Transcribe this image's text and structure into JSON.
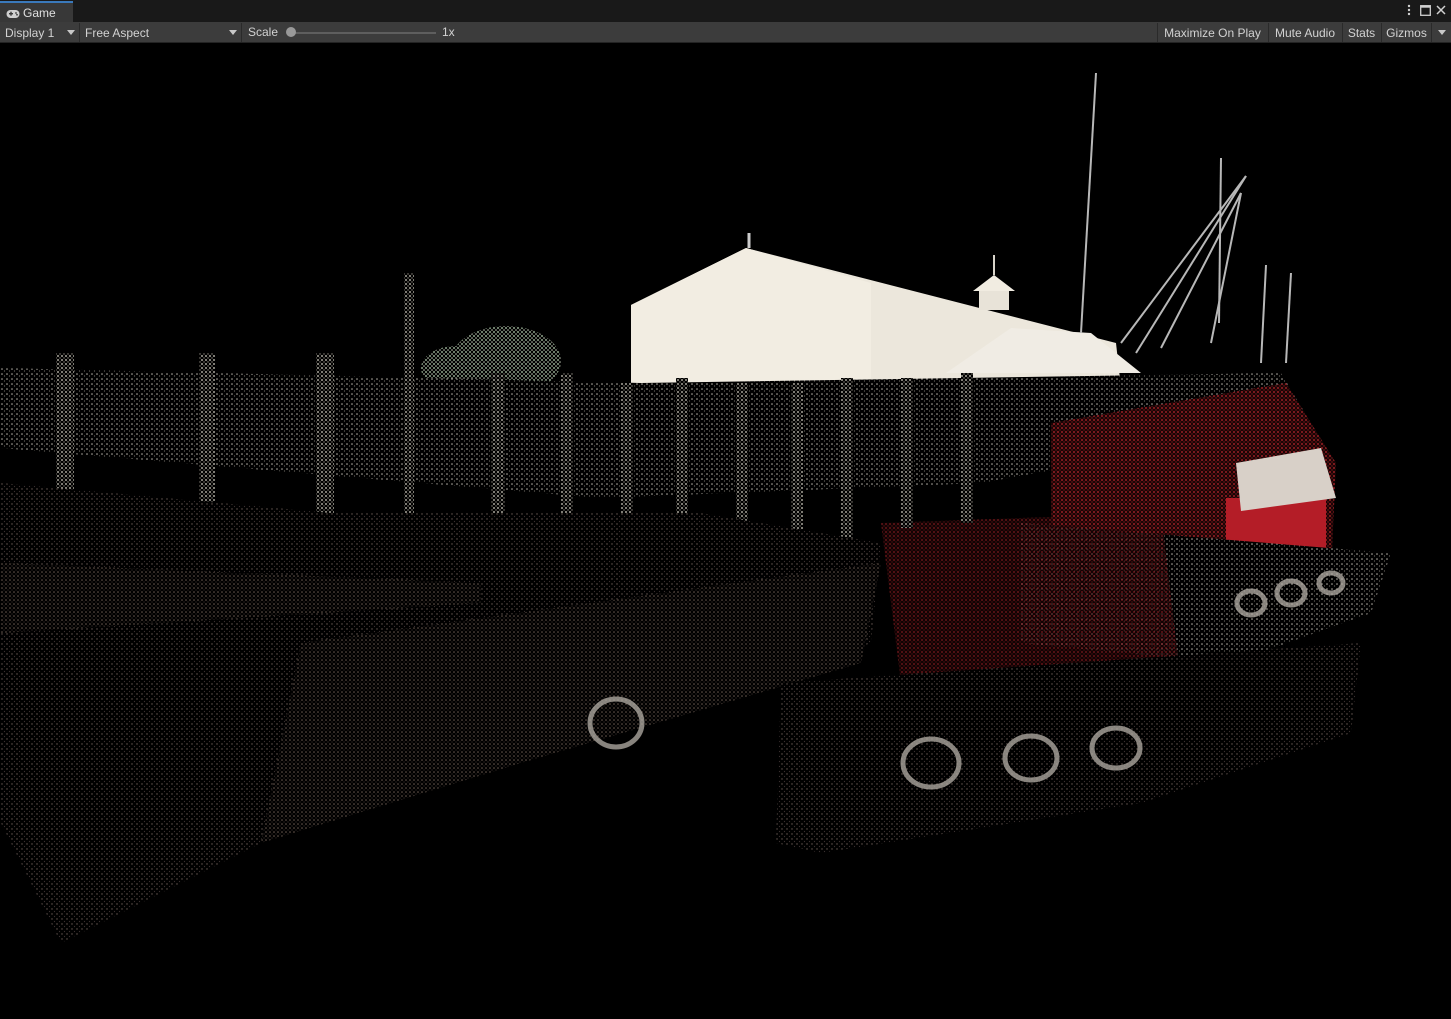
{
  "tab": {
    "title": "Game",
    "icon": "gamepad-icon"
  },
  "window_controls": {
    "menu_icon": "kebab-menu-icon",
    "maximize_icon": "maximize-icon",
    "close_icon": "close-icon"
  },
  "toolbar": {
    "display_label": "Display 1",
    "aspect_label": "Free Aspect",
    "scale_label": "Scale",
    "scale_value": "1x",
    "scale_slider_fraction": 0,
    "maximize_on_play": "Maximize On Play",
    "mute_audio": "Mute Audio",
    "stats": "Stats",
    "gizmos": "Gizmos"
  },
  "colors": {
    "accent": "#3a79bb",
    "toolbar_bg": "#3c3c3c",
    "viewport_bg": "#000000"
  },
  "viewport": {
    "content": "point-cloud-render"
  }
}
